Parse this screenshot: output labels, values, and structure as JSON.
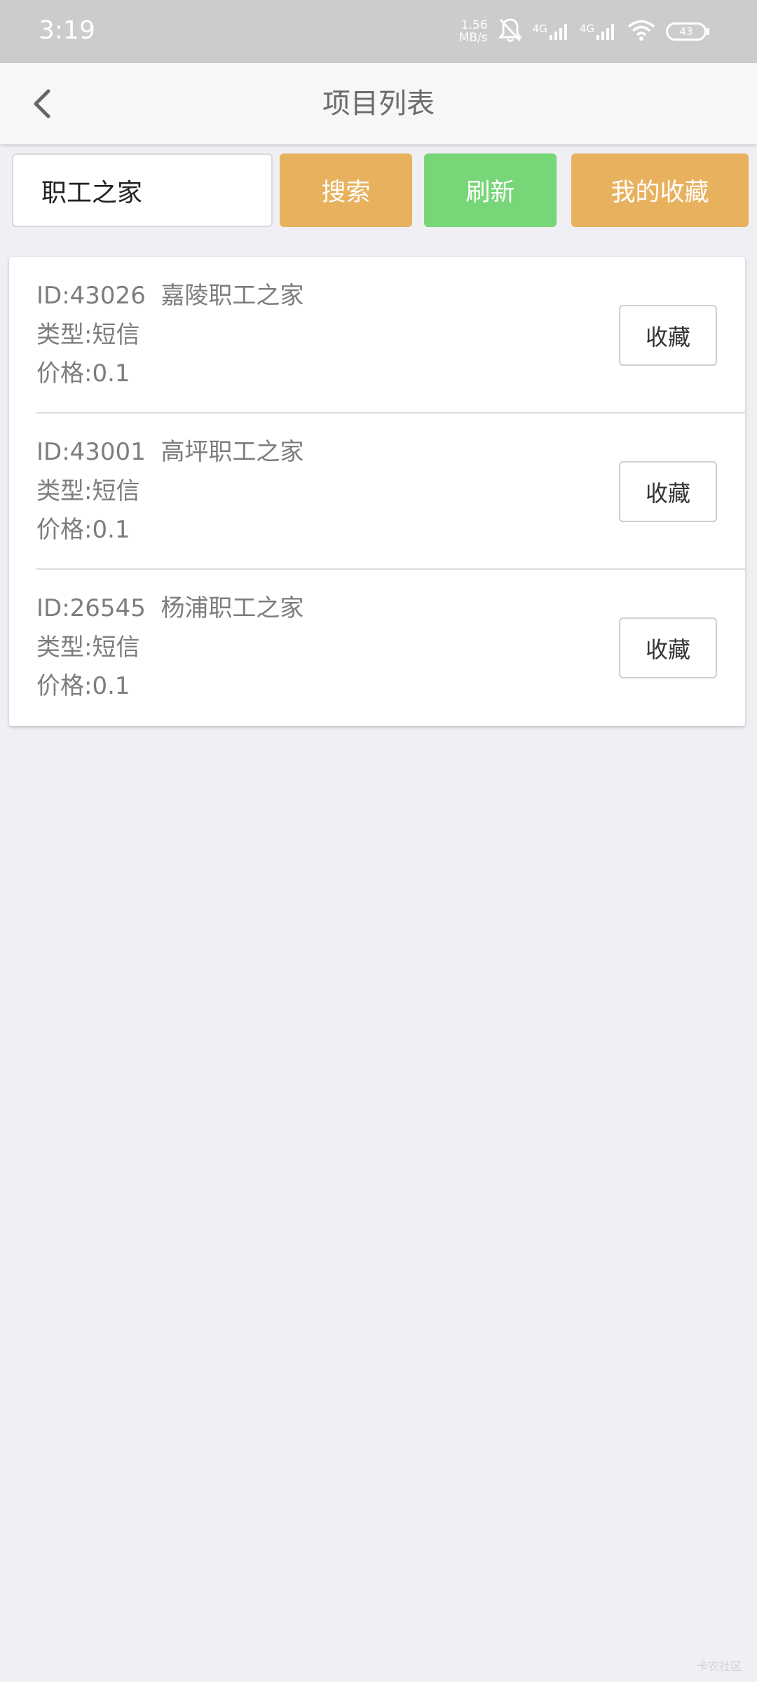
{
  "status_bar": {
    "time": "3:19",
    "net_speed_value": "1.56",
    "net_speed_unit": "MB/s",
    "sim1_label": "4G",
    "sim2_label": "4G",
    "battery_level": "43",
    "icons": [
      "mute-icon",
      "signal-icon",
      "signal-icon",
      "wifi-icon",
      "battery-icon"
    ]
  },
  "header": {
    "title": "项目列表",
    "back_icon": "chevron-left-icon"
  },
  "search": {
    "value": "职工之家",
    "search_label": "搜索",
    "refresh_label": "刷新",
    "favorites_label": "我的收藏"
  },
  "colors": {
    "search_button": "#e8b15e",
    "refresh_button": "#77d677",
    "favorites_button": "#e8b15e",
    "status_bar": "#cccccc",
    "background": "#efeff4"
  },
  "items": [
    {
      "id_line": "ID:43026  嘉陵职工之家",
      "type_line": "类型:短信",
      "price_line": "价格:0.1",
      "fav_label": "收藏"
    },
    {
      "id_line": "ID:43001  高坪职工之家",
      "type_line": "类型:短信",
      "price_line": "价格:0.1",
      "fav_label": "收藏"
    },
    {
      "id_line": "ID:26545  杨浦职工之家",
      "type_line": "类型:短信",
      "price_line": "价格:0.1",
      "fav_label": "收藏"
    }
  ],
  "watermark": "卡农社区"
}
